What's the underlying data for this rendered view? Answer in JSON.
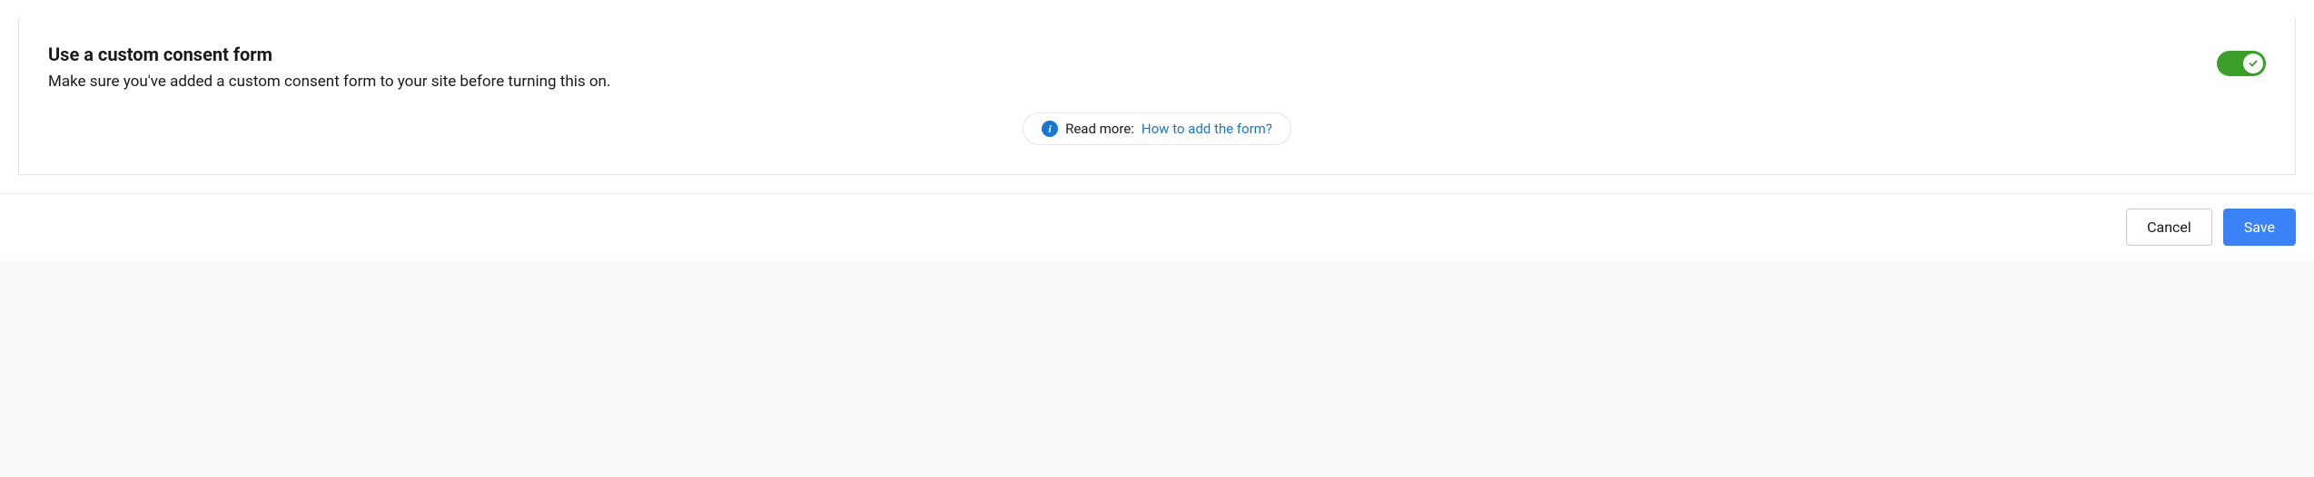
{
  "consent": {
    "title": "Use a custom consent form",
    "description": "Make sure you've added a custom consent form to your site before turning this on.",
    "toggle_on": true,
    "info": {
      "label": "Read more:",
      "link_text": "How to add the form?"
    }
  },
  "footer": {
    "cancel_label": "Cancel",
    "save_label": "Save"
  },
  "colors": {
    "toggle_on": "#3a9e29",
    "link": "#1976d2",
    "primary_button": "#3b82f6"
  }
}
